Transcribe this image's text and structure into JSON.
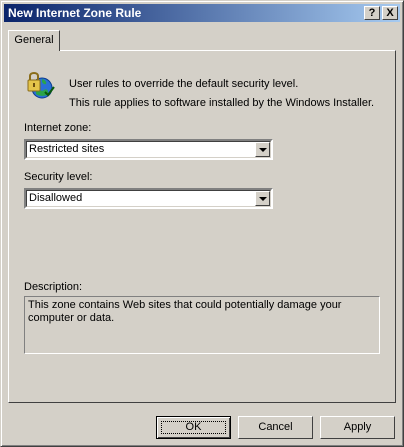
{
  "window": {
    "title": "New Internet Zone Rule",
    "help_button": "?",
    "close_button": "X"
  },
  "tabs": [
    {
      "label": "General"
    }
  ],
  "general": {
    "intro_line1": "User rules to override the default security level.",
    "intro_line2": "This rule applies to software installed by the Windows Installer.",
    "zone_label": "Internet zone:",
    "zone_value": "Restricted sites",
    "security_label": "Security level:",
    "security_value": "Disallowed",
    "description_label": "Description:",
    "description_text": "This zone contains Web sites that could potentially damage your computer or data."
  },
  "buttons": {
    "ok": "OK",
    "cancel": "Cancel",
    "apply": "Apply"
  },
  "icons": {
    "policy": "lock-globe-icon",
    "dropdown": "chevron-down-icon"
  },
  "colors": {
    "dialog_bg": "#d4d0c8",
    "titlebar_start": "#0a246a",
    "titlebar_end": "#a6caf0"
  }
}
